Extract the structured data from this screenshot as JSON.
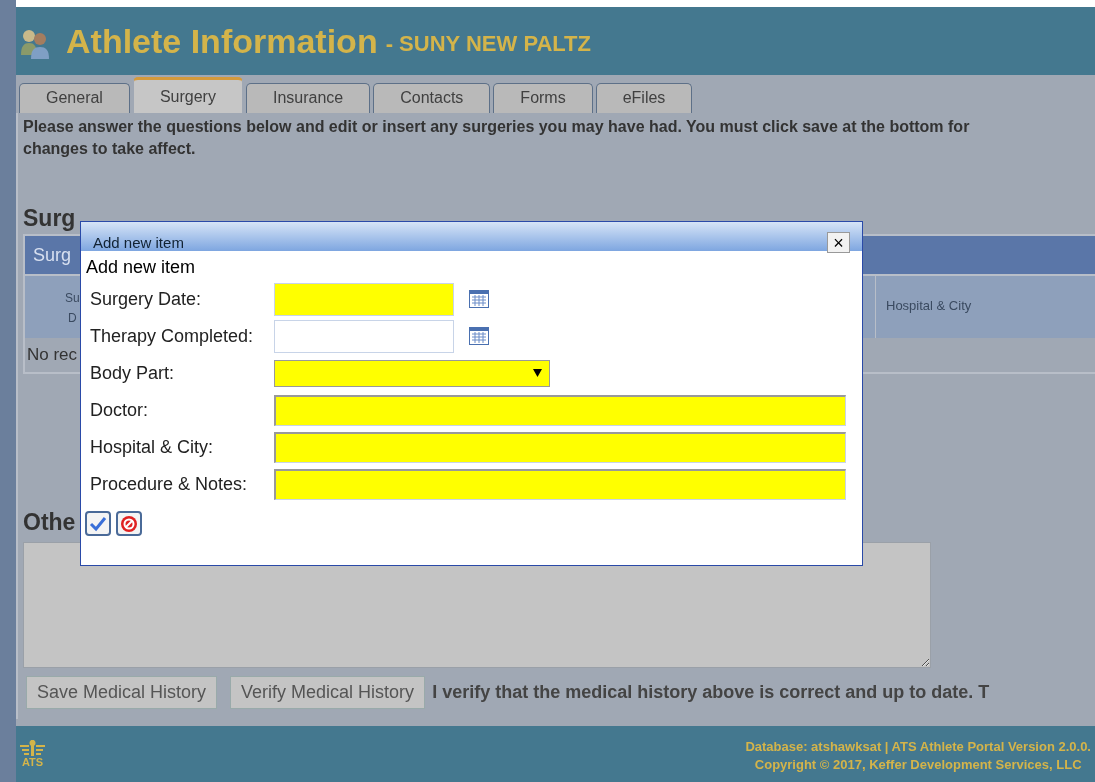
{
  "header": {
    "title": "Athlete Information",
    "subtitle": "- SUNY NEW PALTZ"
  },
  "tabs": [
    {
      "label": "General",
      "selected": false
    },
    {
      "label": "Surgery",
      "selected": true
    },
    {
      "label": "Insurance",
      "selected": false
    },
    {
      "label": "Contacts",
      "selected": false
    },
    {
      "label": "Forms",
      "selected": false
    },
    {
      "label": "eFiles",
      "selected": false
    }
  ],
  "instructions": "Please answer the questions below and edit or insert any surgeries you may have had. You must click save at the bottom for changes to take affect.",
  "surgeries": {
    "heading": "Surg",
    "grid_title": "Surg",
    "column_1": [
      "Su",
      "D"
    ],
    "column_2": "Hospital & City",
    "empty_text": "No rec"
  },
  "other": {
    "heading": "Othe"
  },
  "buttons": [
    {
      "label": "Save Medical History"
    },
    {
      "label": "Verify Medical History"
    }
  ],
  "verify_text": "I verify that the medical history above is correct and up to date. T",
  "dialog": {
    "title": "Add new item",
    "close": "×",
    "heading": "Add new item",
    "fields": [
      {
        "label": "Surgery Date:",
        "kind": "date",
        "required": true
      },
      {
        "label": "Therapy Completed:",
        "kind": "date",
        "required": false
      },
      {
        "label": "Body Part:",
        "kind": "select",
        "required": true
      },
      {
        "label": "Doctor:",
        "kind": "text",
        "required": true
      },
      {
        "label": "Hospital & City:",
        "kind": "text",
        "required": true
      },
      {
        "label": "Procedure & Notes:",
        "kind": "text",
        "required": true
      }
    ]
  },
  "footer": {
    "logo_text": "ATS",
    "line_1": "Database: atshawksat | ATS Athlete Portal Version 2.0.0.",
    "line_2": "Copyright © 2017, Keffer Development Services, LLC"
  }
}
